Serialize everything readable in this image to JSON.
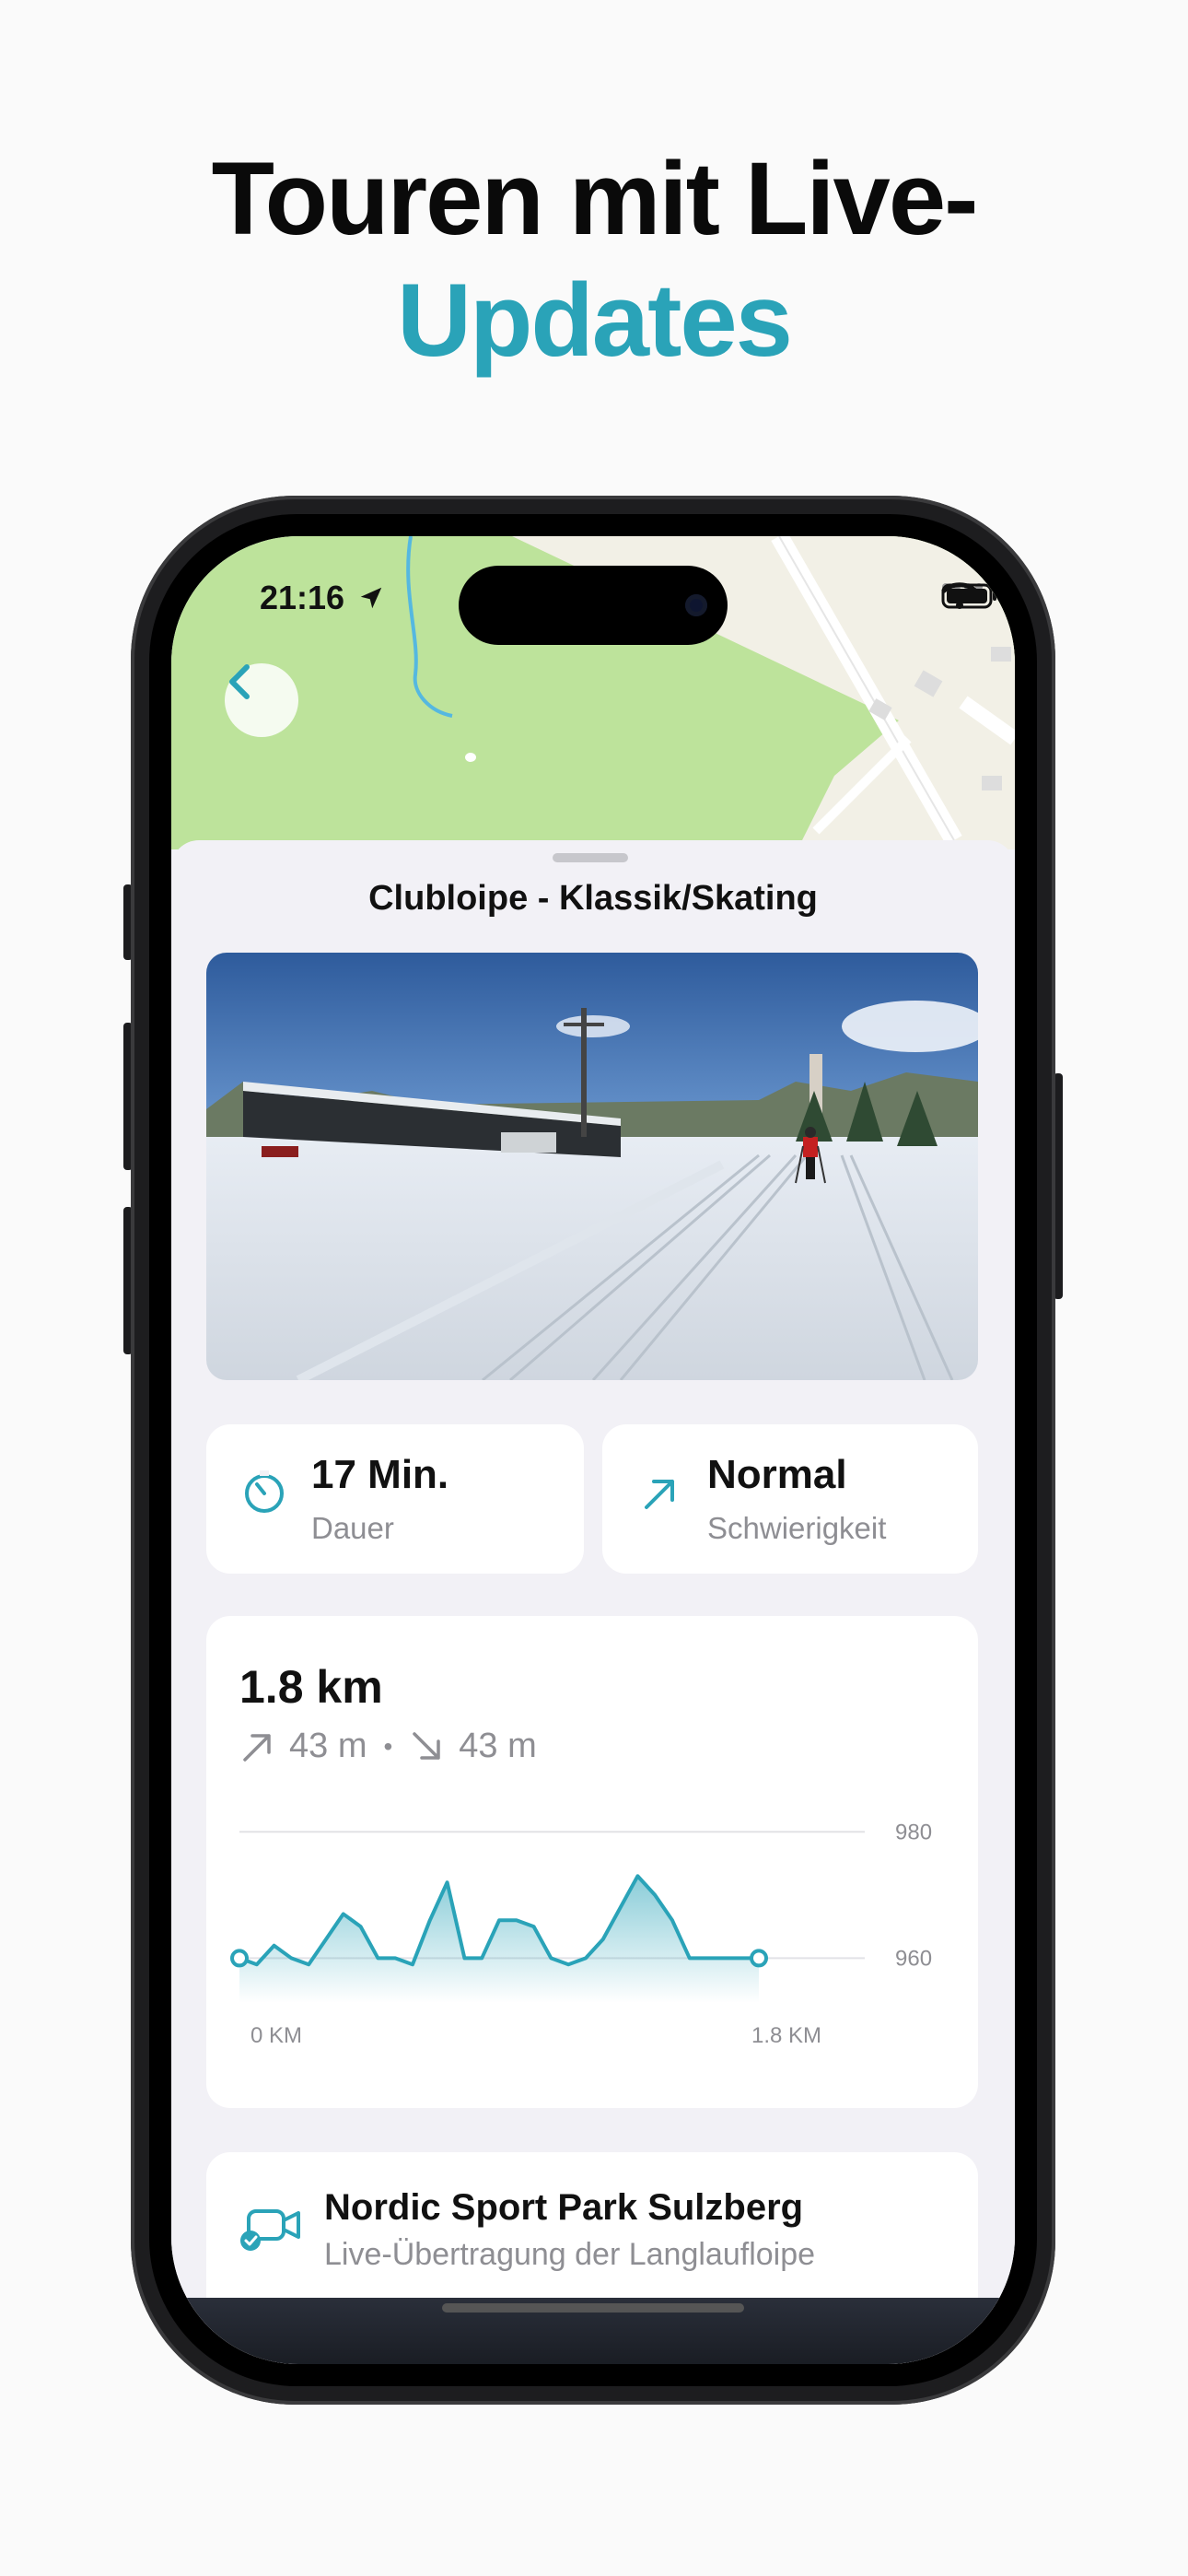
{
  "headline": {
    "line1": "Touren mit Live-",
    "line2": "Updates"
  },
  "colors": {
    "accent": "#2aa3b8",
    "map_green": "#bde39b",
    "text_secondary": "#8e8e93"
  },
  "status_bar": {
    "time": "21:16",
    "icons": [
      "location-arrow-icon",
      "wifi-icon",
      "battery-icon"
    ]
  },
  "map": {
    "back_icon": "chevron-left-icon"
  },
  "tour": {
    "title": "Clubloipe - Klassik/Skating"
  },
  "stats": [
    {
      "icon": "timer-icon",
      "value": "17 Min.",
      "label": "Dauer"
    },
    {
      "icon": "arrow-up-right-icon",
      "value": "Normal",
      "label": "Schwierigkeit"
    }
  ],
  "elevation": {
    "distance": "1.8 km",
    "ascent": "43 m",
    "separator": "•",
    "descent": "43 m"
  },
  "chart_data": {
    "type": "area",
    "x": [
      0,
      0.06,
      0.12,
      0.18,
      0.24,
      0.3,
      0.36,
      0.42,
      0.48,
      0.54,
      0.6,
      0.66,
      0.72,
      0.78,
      0.84,
      0.9,
      0.96,
      1.02,
      1.08,
      1.14,
      1.2,
      1.26,
      1.32,
      1.38,
      1.44,
      1.5,
      1.56,
      1.62,
      1.68,
      1.74,
      1.8
    ],
    "series": [
      {
        "values": [
          960,
          959,
          962,
          960,
          959,
          963,
          967,
          965,
          960,
          960,
          959,
          966,
          972,
          960,
          960,
          966,
          966,
          965,
          960,
          959,
          960,
          963,
          968,
          973,
          970,
          966,
          960,
          960,
          960,
          960,
          960
        ]
      }
    ],
    "ylim": [
      950,
      985
    ],
    "y_ticks": [
      "980",
      "960"
    ],
    "x_ticks": [
      "0 KM",
      "1.8 KM"
    ],
    "grid": true
  },
  "webcam": {
    "icon": "webcam-icon",
    "name": "Nordic Sport Park Sulzberg",
    "subtitle": "Live-Übertragung der Langlaufloipe"
  }
}
